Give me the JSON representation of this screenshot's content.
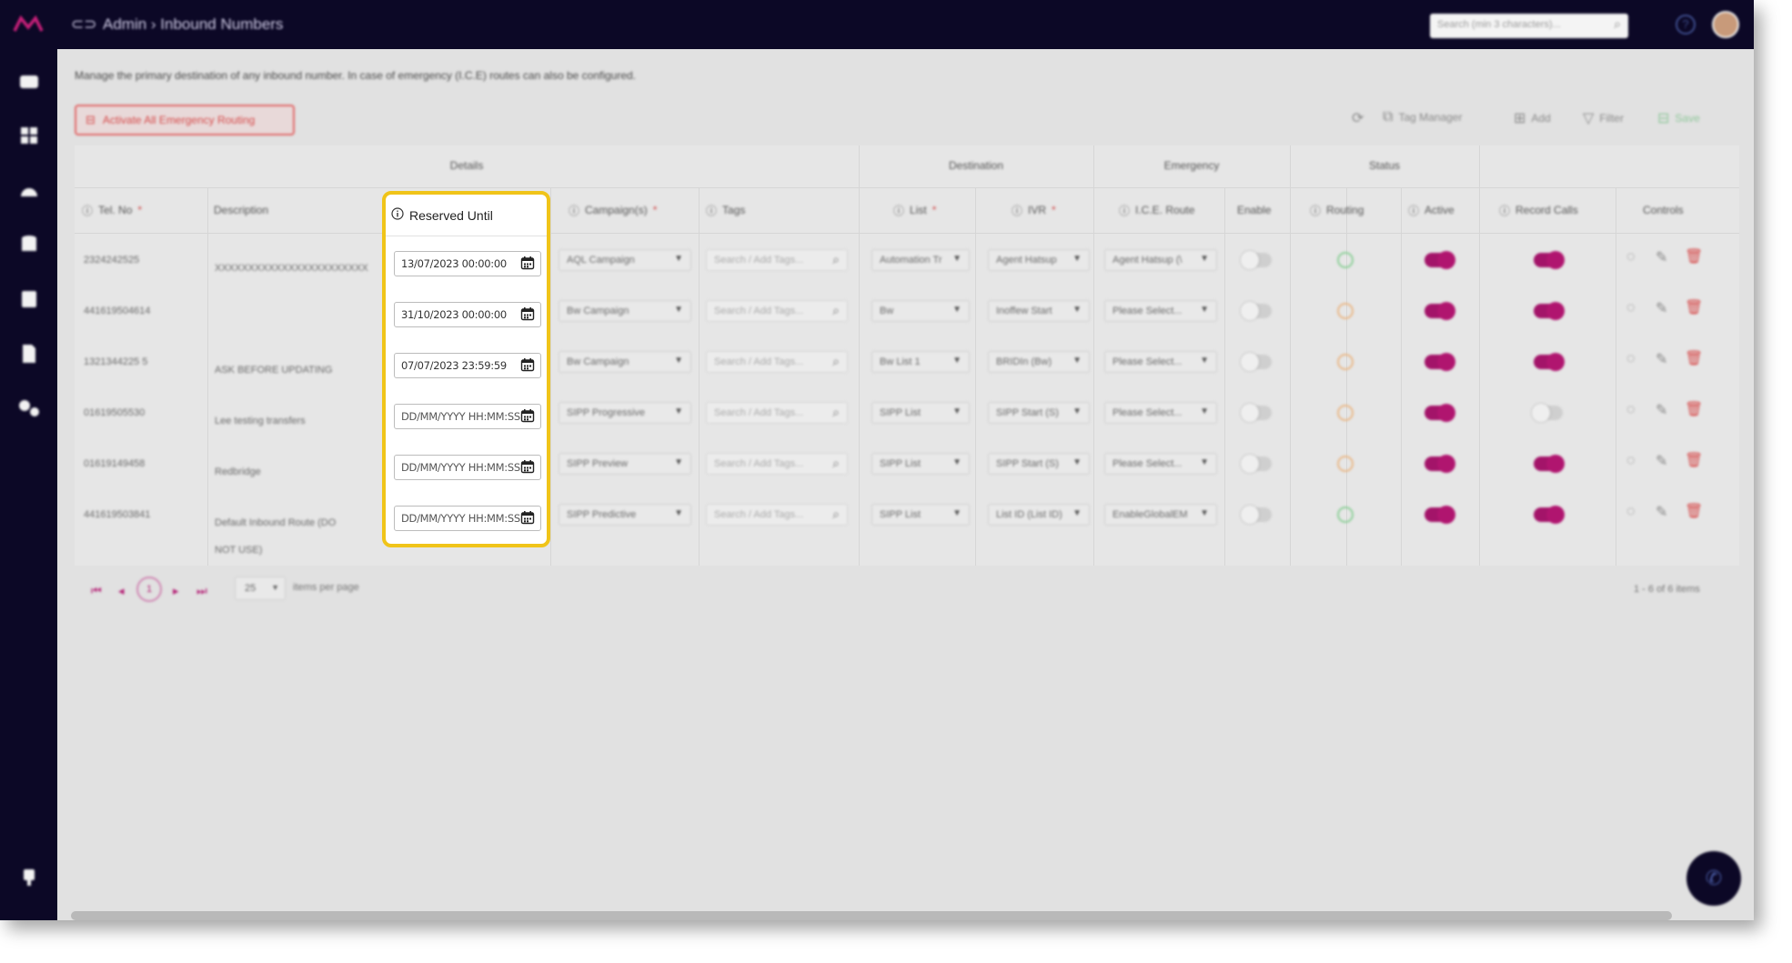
{
  "topbar": {
    "title": "Admin › Inbound Numbers",
    "search_placeholder": "Search (min 3 characters)..."
  },
  "description": "Manage the primary destination of any inbound number. In case of emergency (I.C.E) routes can also be configured.",
  "emergency_button": "Activate All Emergency Routing",
  "toolbar": {
    "tag_manager": "Tag Manager",
    "add": "Add",
    "filter": "Filter",
    "save": "Save"
  },
  "groups": [
    "Details",
    "Destination",
    "Emergency",
    "Status"
  ],
  "columns": {
    "tel": "Tel. No",
    "description": "Description",
    "reserved_until": "Reserved Until",
    "campaigns": "Campaign(s)",
    "tags": "Tags",
    "list": "List",
    "ivr": "IVR",
    "ice_route": "I.C.E. Route",
    "enable": "Enable",
    "routing": "Routing",
    "active": "Active",
    "record_calls": "Record Calls",
    "controls": "Controls"
  },
  "tags_placeholder": "Search / Add Tags...",
  "rows": [
    {
      "tel": "2324242525",
      "desc": "XXXXXXXXXXXXXXXXXXXXXXX",
      "reserved": "13/07/2023 00:00:00",
      "campaign": "AQL Campaign",
      "list": "Automation Tr",
      "ivr": "Agent Hatsup",
      "ice": "Agent Hatsup (\\",
      "enable": false,
      "routing": "green",
      "active": true,
      "record": true
    },
    {
      "tel": "441619504614",
      "desc": "",
      "reserved": "31/10/2023 00:00:00",
      "campaign": "Bw Campaign",
      "list": "Bw",
      "ivr": "Inoffew Start",
      "ice": "Please Select...",
      "enable": false,
      "routing": "orange",
      "active": true,
      "record": true
    },
    {
      "tel": "1321344225 5",
      "desc": "ASK BEFORE UPDATING",
      "reserved": "07/07/2023 23:59:59",
      "campaign": "Bw Campaign",
      "list": "Bw List 1",
      "ivr": "BRIDIn (Bw)",
      "ice": "Please Select...",
      "enable": false,
      "routing": "orange",
      "active": true,
      "record": true
    },
    {
      "tel": "01619505530",
      "desc": "Lee testing transfers",
      "reserved": "",
      "campaign": "SIPP Progressive",
      "list": "SIPP List",
      "ivr": "SIPP Start (S)",
      "ice": "Please Select...",
      "enable": false,
      "routing": "orange",
      "active": true,
      "record": false
    },
    {
      "tel": "01619149458",
      "desc": "Redbridge",
      "reserved": "",
      "campaign": "SIPP Preview",
      "list": "SIPP List",
      "ivr": "SIPP Start (S)",
      "ice": "Please Select...",
      "enable": false,
      "routing": "orange",
      "active": true,
      "record": true
    },
    {
      "tel": "441619503841",
      "desc": "Default Inbound Route (DO NOT USE)",
      "reserved": "",
      "campaign": "SIPP Predictive",
      "list": "SIPP List",
      "ivr": "List ID (List ID)",
      "ice": "EnableGlobalEM",
      "enable": false,
      "routing": "green",
      "active": true,
      "record": true
    }
  ],
  "date_placeholder": "DD/MM/YYYY HH:MM:SS",
  "pager": {
    "current": "1",
    "page_size": "25",
    "per_page_label": "items per page",
    "summary": "1 - 6 of 6 items"
  },
  "colors": {
    "accent": "#a31469",
    "nav": "#0c0826",
    "highlight": "#f0c419"
  }
}
